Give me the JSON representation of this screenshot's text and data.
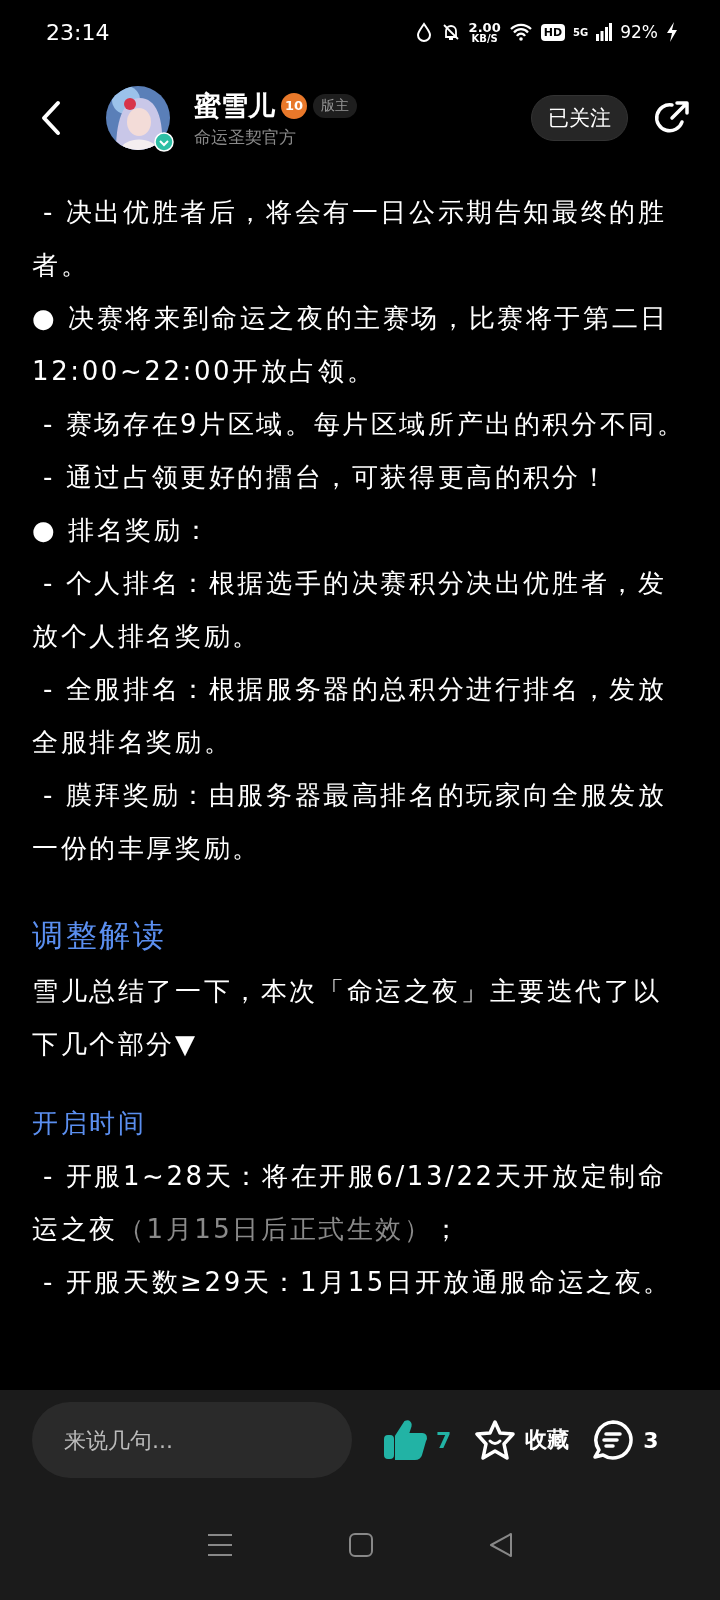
{
  "status_bar": {
    "time": "23:14",
    "speed": "2.00",
    "speed_unit": "KB/S",
    "hd": "HD",
    "network": "5G",
    "battery": "92%"
  },
  "header": {
    "author": "蜜雪儿",
    "level": "10",
    "role": "版主",
    "subtitle": "命运圣契官方",
    "follow_label": "已关注",
    "following": true
  },
  "content": [
    {
      "kind": "text",
      "parts": [
        {
          "text": " - 决出优胜者后，将会有一日公示期告知最终的胜者。",
          "muted": false
        }
      ]
    },
    {
      "kind": "text",
      "parts": [
        {
          "text": "● 决赛将来到命运之夜的主赛场，比赛将于第二日12:00~22:00开放占领。",
          "muted": false
        }
      ]
    },
    {
      "kind": "text",
      "parts": [
        {
          "text": " - 赛场存在9片区域。每片区域所产出的积分不同。",
          "muted": false
        }
      ]
    },
    {
      "kind": "text",
      "parts": [
        {
          "text": " - 通过占领更好的擂台，可获得更高的积分！",
          "muted": false
        }
      ]
    },
    {
      "kind": "text",
      "parts": [
        {
          "text": "● 排名奖励：",
          "muted": false
        }
      ]
    },
    {
      "kind": "text",
      "parts": [
        {
          "text": " - 个人排名：根据选手的决赛积分决出优胜者，发放个人排名奖励。",
          "muted": false
        }
      ]
    },
    {
      "kind": "text",
      "parts": [
        {
          "text": " - 全服排名：根据服务器的总积分进行排名，发放全服排名奖励。",
          "muted": false
        }
      ]
    },
    {
      "kind": "text",
      "parts": [
        {
          "text": " - 膜拜奖励：由服务器最高排名的玩家向全服发放一份的丰厚奖励。",
          "muted": false
        }
      ]
    },
    {
      "kind": "heading",
      "parts": [
        {
          "text": "调整解读",
          "muted": false
        }
      ]
    },
    {
      "kind": "text",
      "parts": [
        {
          "text": "雪儿总结了一下，本次「命运之夜」主要迭代了以下几个部分▼",
          "muted": false
        }
      ]
    },
    {
      "kind": "subheading",
      "parts": [
        {
          "text": "开启时间",
          "muted": false
        }
      ]
    },
    {
      "kind": "text",
      "parts": [
        {
          "text": " - 开服1~28天：将在开服6/13/22天开放定制命运之夜",
          "muted": false
        },
        {
          "text": "（1月15日后正式生效）",
          "muted": true
        },
        {
          "text": "；",
          "muted": false
        }
      ]
    },
    {
      "kind": "text",
      "parts": [
        {
          "text": " - 开服天数≥29天：1月15日开放通服命运之夜。",
          "muted": false
        }
      ]
    }
  ],
  "bottom_bar": {
    "comment_placeholder": "来说几句...",
    "likes": "7",
    "liked": true,
    "favorite_label": "收藏",
    "favorited": false,
    "comments": "3"
  }
}
